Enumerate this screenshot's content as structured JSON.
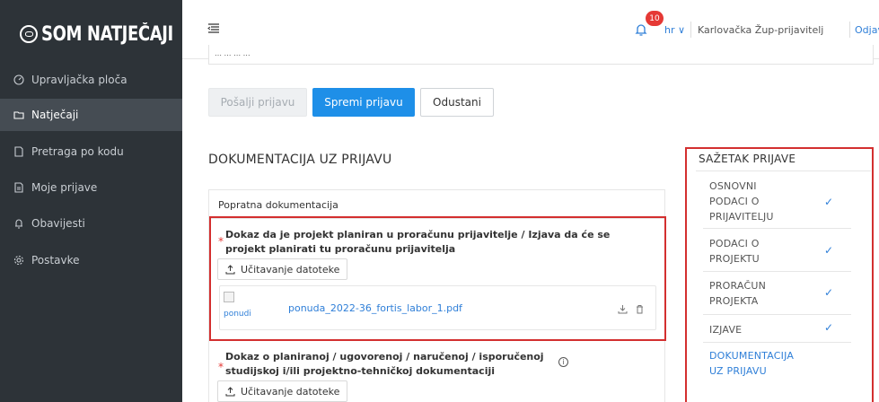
{
  "app": {
    "logo": "SOM NATJEČAJI"
  },
  "sidebar": {
    "items": [
      {
        "label": "Upravljačka ploča",
        "icon": "dashboard-icon"
      },
      {
        "label": "Natječaji",
        "icon": "folder-icon",
        "active": true
      },
      {
        "label": "Pretraga po kodu",
        "icon": "document-icon"
      },
      {
        "label": "Moje prijave",
        "icon": "document-icon"
      },
      {
        "label": "Obavijesti",
        "icon": "bell-icon"
      },
      {
        "label": "Postavke",
        "icon": "gear-icon"
      }
    ]
  },
  "topbar": {
    "notifications_count": "10",
    "language": "hr ∨",
    "user": "Karlovačka Žup-prijavitelj",
    "logout": "Odjava"
  },
  "top_input": {
    "value": "… … … …"
  },
  "actions": {
    "send": "Pošalji prijavu",
    "save": "Spremi prijavu",
    "cancel": "Odustani"
  },
  "documentation": {
    "title": "DOKUMENTACIJA UZ PRIJAVU",
    "panel_header": "Popratna dokumentacija",
    "doc1": {
      "required_mark": "*",
      "label_line1": "Dokaz da je projekt planiran u proračunu prijavitelje / Izjava da će se",
      "label_line2": "projekt planirati tu proračunu prijavitelja",
      "upload": "Učitavanje datoteke",
      "file_thumb_alt": "ponudi",
      "file_name": "ponuda_2022-36_fortis_labor_1.pdf"
    },
    "doc2": {
      "required_mark": "*",
      "label_line1": "Dokaz o planiranoj / ugovorenoj / naručenoj / isporučenoj",
      "label_line2": "studijskoj i/ili projektno-tehničkoj dokumentaciji",
      "info": "i",
      "upload": "Učitavanje datoteke"
    }
  },
  "summary": {
    "title": "SAŽETAK PRIJAVE",
    "check": "✓",
    "items": [
      {
        "l1": "OSNOVNI",
        "l2": "PODACI O",
        "l3": "PRIJAVITELJU",
        "done": true
      },
      {
        "l1": "PODACI O",
        "l2": "PROJEKTU",
        "done": true
      },
      {
        "l1": "PRORAČUN",
        "l2": "PROJEKTA",
        "done": true
      },
      {
        "l1": "IZJAVE",
        "done": true
      },
      {
        "l1": "DOKUMENTACIJA",
        "l2": "UZ PRIJAVU",
        "active": true
      }
    ]
  },
  "colors": {
    "accent": "#1e8fe8",
    "sidebar": "#2d3338",
    "highlight": "#d32f2f",
    "badge": "#e53935"
  }
}
